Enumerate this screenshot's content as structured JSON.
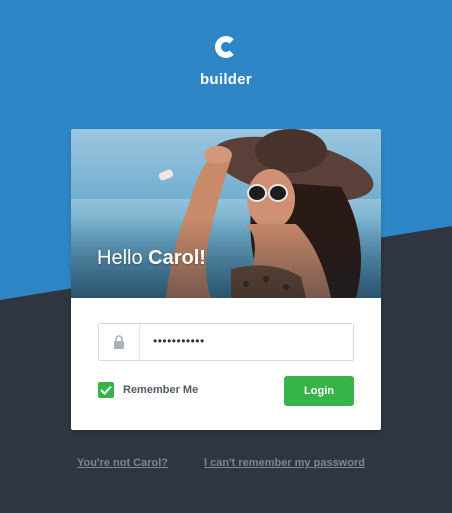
{
  "brand": {
    "name": "builder",
    "mark": "C"
  },
  "card": {
    "greeting_prefix": "Hello",
    "user_name": "Carol!",
    "password_value": "•••••••••••",
    "remember_label": "Remember Me",
    "remember_checked": true,
    "login_label": "Login"
  },
  "links": {
    "not_user": "You're not Carol?",
    "forgot_password": "I can't remember my password"
  },
  "colors": {
    "primary_blue": "#2f86c6",
    "dark_bg": "#2f3640",
    "green": "#36b44a"
  },
  "icons": [
    "c-logo-icon",
    "lock-icon",
    "checkmark-icon"
  ]
}
